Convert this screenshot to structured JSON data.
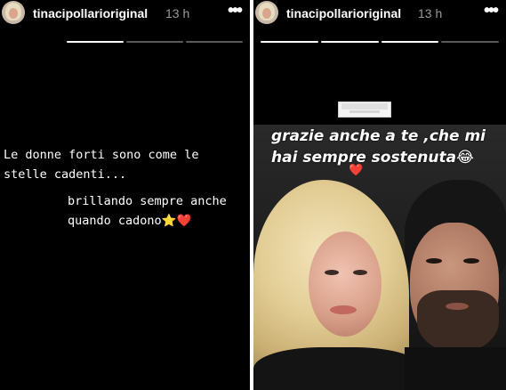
{
  "left_story": {
    "username": "tinacipollarioriginal",
    "time": "13 h",
    "more_label": "•••",
    "progress": [
      1,
      1,
      0,
      0
    ],
    "quote_lines": [
      "Le donne forti sono come le",
      "stelle cadenti..."
    ],
    "quote2_line1": "brillando sempre anche",
    "quote2_line2": "quando cadono",
    "star_glyph": "⭐",
    "heart_glyph": "❤️"
  },
  "right_story": {
    "username": "tinacipollarioriginal",
    "time": "13 h",
    "more_label": "•••",
    "progress": [
      1,
      1,
      1,
      0
    ],
    "caption_line1": "grazie anche a te ,che mi",
    "caption_line2": "hai sempre sostenuta",
    "emoji": "😂",
    "heart_glyph": "❤️"
  },
  "colors": {
    "background": "#000000",
    "text": "#ffffff",
    "time_gray": "#9a9a9a",
    "heart": "#e23b3b"
  }
}
